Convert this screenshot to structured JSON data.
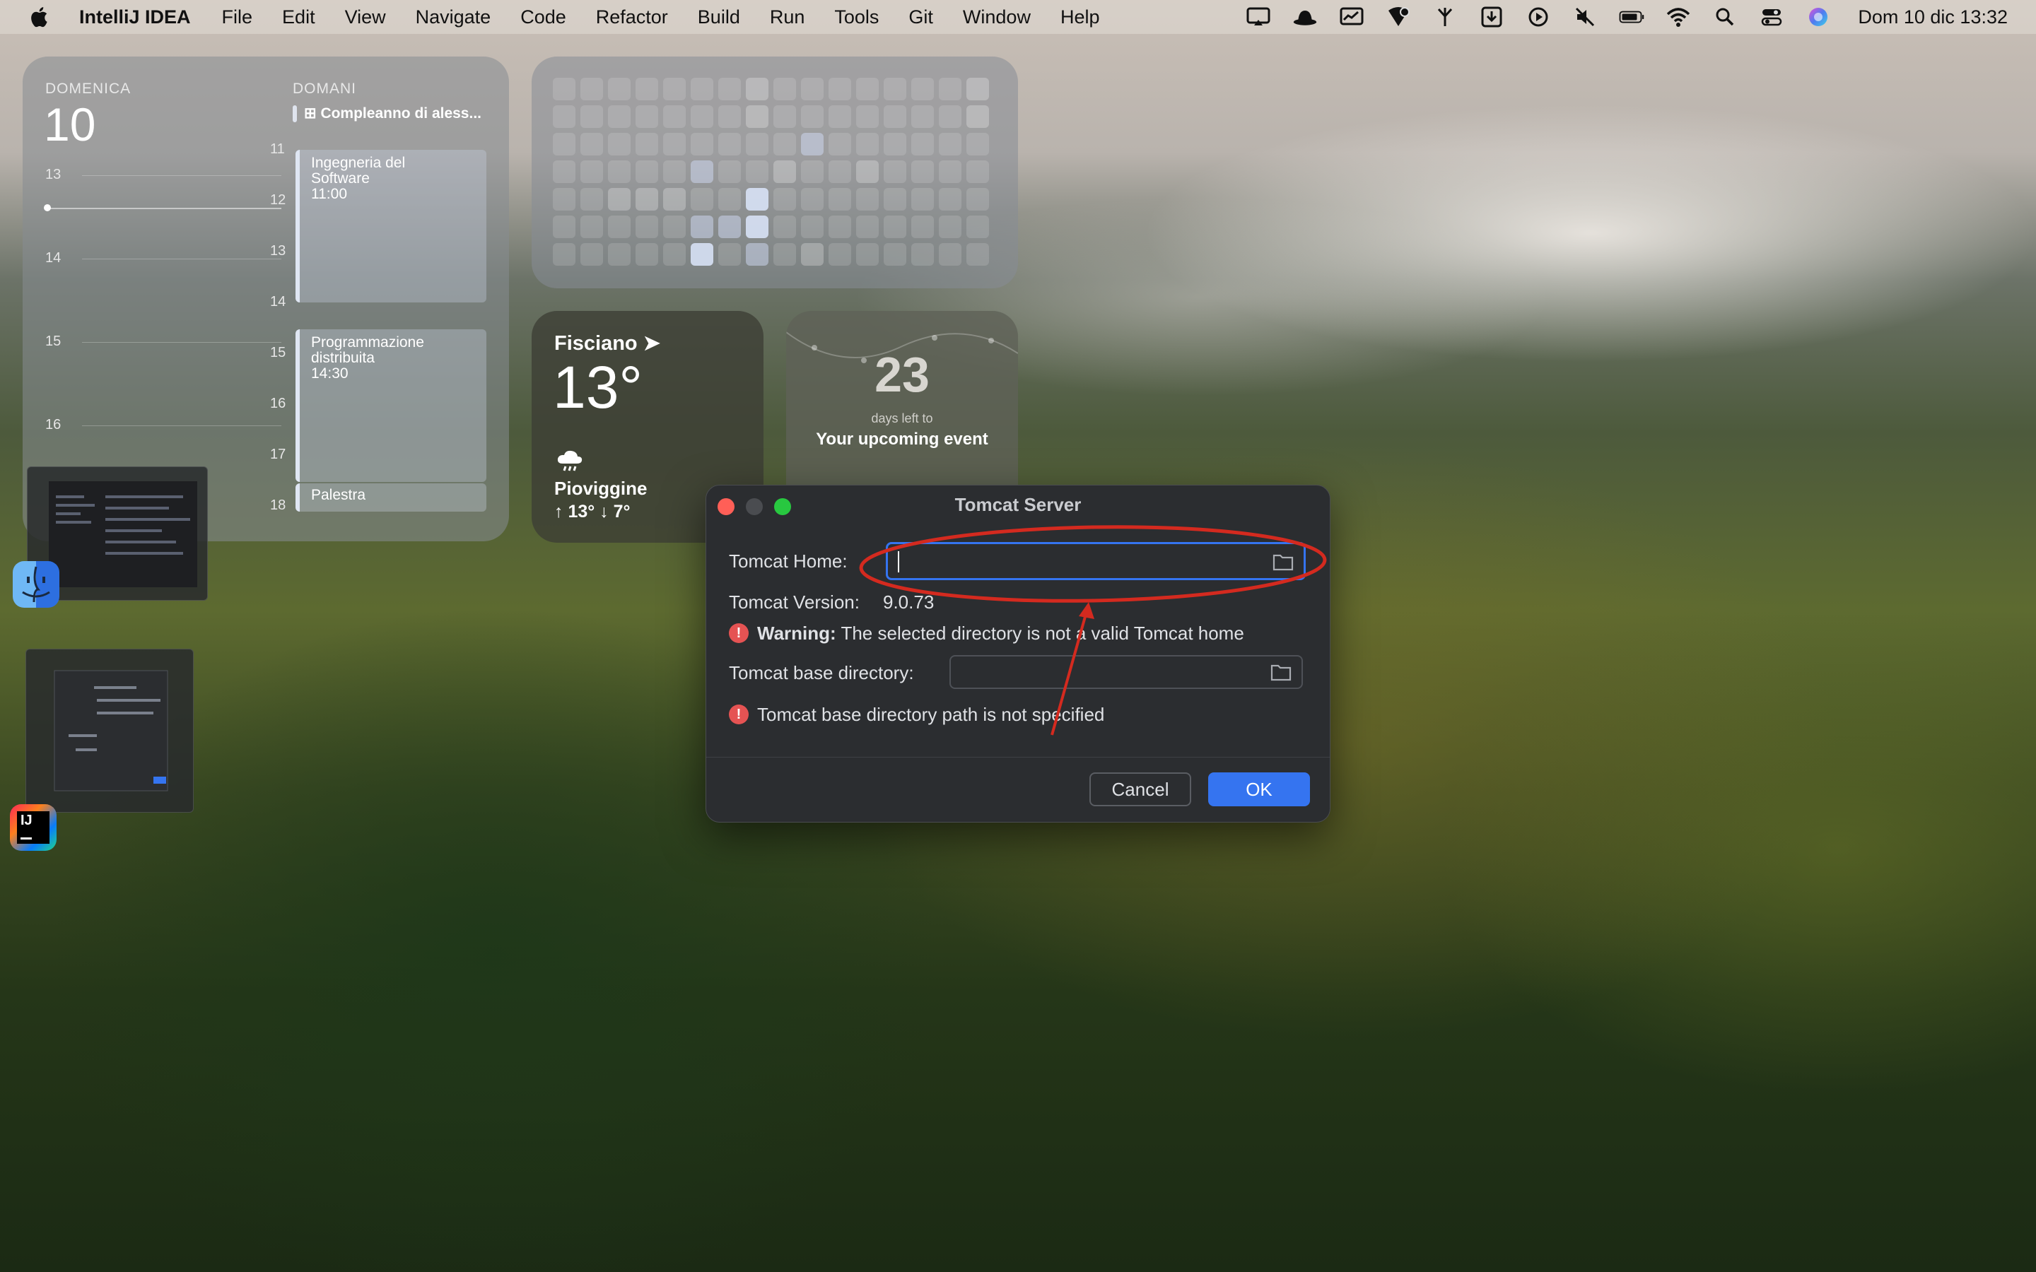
{
  "menubar": {
    "app_name": "IntelliJ IDEA",
    "menus": [
      "File",
      "Edit",
      "View",
      "Navigate",
      "Code",
      "Refactor",
      "Build",
      "Run",
      "Tools",
      "Git",
      "Window",
      "Help"
    ],
    "clock": "Dom 10 dic  13:32"
  },
  "calendar_widget": {
    "today_label": "DOMENICA",
    "today_number": "10",
    "tomorrow_label": "DOMANI",
    "tomorrow_event": "Compleanno di aless...",
    "left_hours": [
      "13",
      "14",
      "15",
      "16"
    ],
    "right_hours": [
      "11",
      "12",
      "13",
      "14",
      "15",
      "16",
      "17",
      "18"
    ],
    "events": [
      {
        "title": "Ingegneria del Software",
        "time": "11:00"
      },
      {
        "title": "Programmazione distribuita",
        "time": "14:30"
      },
      {
        "title": "Palestra",
        "time": ""
      }
    ]
  },
  "weather_widget": {
    "city": "Fisciano",
    "temperature": "13°",
    "condition": "Pioviggine",
    "high_low": "↑ 13° ↓ 7°"
  },
  "countdown_widget": {
    "days": "23",
    "subtitle": "days left to",
    "event": "Your upcoming event"
  },
  "dialog": {
    "title": "Tomcat Server",
    "home_label": "Tomcat Home:",
    "home_value": "",
    "version_label": "Tomcat Version:",
    "version_value": "9.0.73",
    "warning_bold": "Warning:",
    "warning_text": "The selected directory is not a valid Tomcat home",
    "base_label": "Tomcat base directory:",
    "base_value": "",
    "base_error": "Tomcat base directory path is not specified",
    "cancel_label": "Cancel",
    "ok_label": "OK"
  },
  "colors": {
    "accent": "#3574f0",
    "error": "#e55353",
    "annotation": "#d42a1f"
  }
}
